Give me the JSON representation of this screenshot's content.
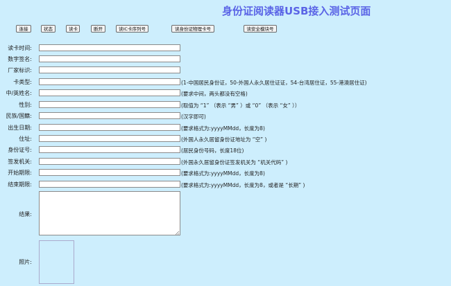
{
  "title": "身份证阅读器USB接入测试页面",
  "buttons": {
    "connect": "连接",
    "status": "状态",
    "read": "读卡",
    "disconnect": "断开",
    "ic_serial": "读IC卡序列号",
    "physical_no": "读身份证物理卡号",
    "sam_no": "读安全模块号"
  },
  "fields": {
    "read_time": {
      "label": "读卡时间:",
      "value": "",
      "hint": ""
    },
    "signature": {
      "label": "数字签名:",
      "value": "",
      "hint": ""
    },
    "vendor": {
      "label": "厂家标识:",
      "value": "",
      "hint": ""
    },
    "card_type": {
      "label": "卡类型:",
      "value": "",
      "hint": "(1-中国居民身份证，50-外国人永久居住证证，54-台湾居住证，55-港澳居住证)"
    },
    "name": {
      "label": "中/英姓名:",
      "value": "",
      "hint": "(要求中间，两头都没有空格)"
    },
    "gender": {
      "label": "性别:",
      "value": "",
      "hint": "(取值为 “1” （表示 “男” ）或 “0” （表示 “女” ））"
    },
    "ethnicity": {
      "label": "民族/国籍:",
      "value": "",
      "hint": "(汉字即可)"
    },
    "birth": {
      "label": "出生日期:",
      "value": "",
      "hint": "(要求格式为:yyyyMMdd，长度为8)"
    },
    "address": {
      "label": "住址:",
      "value": "",
      "hint": "(外国人永久居留身份证地址为 “空” )"
    },
    "id_number": {
      "label": "身份证号:",
      "value": "",
      "hint": "(居民身份号码，长度18位)"
    },
    "authority": {
      "label": "签发机关:",
      "value": "",
      "hint": "(外国永久居留身份证签发机关为 “机关代码” )"
    },
    "start_date": {
      "label": "开始期限:",
      "value": "",
      "hint": "(要求格式为:yyyyMMdd，长度为8)"
    },
    "end_date": {
      "label": "结束期限:",
      "value": "",
      "hint": "(要求格式为:yyyyMMdd，长度为8，或者是 “长期” )"
    }
  },
  "result": {
    "label": "结果:",
    "value": ""
  },
  "photo": {
    "label": "照片:"
  }
}
